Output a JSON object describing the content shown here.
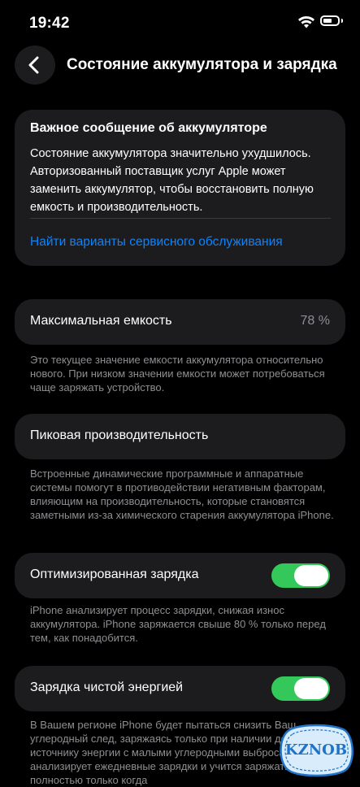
{
  "status_bar": {
    "time": "19:42"
  },
  "nav": {
    "title": "Состояние аккумулятора и зарядка"
  },
  "alert": {
    "title": "Важное сообщение об аккумуляторе",
    "body": "Состояние аккумулятора значительно ухудшилось. Авторизованный поставщик услуг Apple может заменить аккумулятор, чтобы восстановить полную емкость и производительность.",
    "link": "Найти варианты сервисного обслуживания"
  },
  "max_capacity": {
    "label": "Максимальная емкость",
    "value": "78 %",
    "footnote": "Это текущее значение емкости аккумулятора относительно нового. При низком значении емкости может потребоваться чаще заряжать устройство."
  },
  "peak_performance": {
    "label": "Пиковая производительность",
    "footnote": "Встроенные динамические программные и аппаратные системы помогут в противодействии негативным факторам, влияющим на производительность, которые становятся заметными из-за химического старения аккумулятора iPhone."
  },
  "optimized_charging": {
    "label": "Оптимизированная зарядка",
    "enabled": true,
    "footnote": "iPhone анализирует процесс зарядки, снижая износ аккумулятора. iPhone заряжается свыше 80 % только перед тем, как понадобится."
  },
  "clean_energy": {
    "label": "Зарядка чистой энергией",
    "enabled": true,
    "footnote": "В Вашем регионе iPhone будет пытаться снизить Ваш углеродный след, заряжаясь только при наличии доступа к источнику энергии с малыми углеродными выбросами. iPhone анализирует ежедневные зарядки и учится заряжать полностью только когда"
  },
  "watermark": {
    "text": "KZNOB"
  },
  "colors": {
    "accent": "#0a84ff",
    "toggle_on": "#34c759",
    "card": "#1c1c1e",
    "secondary_text": "#8e8e93"
  }
}
